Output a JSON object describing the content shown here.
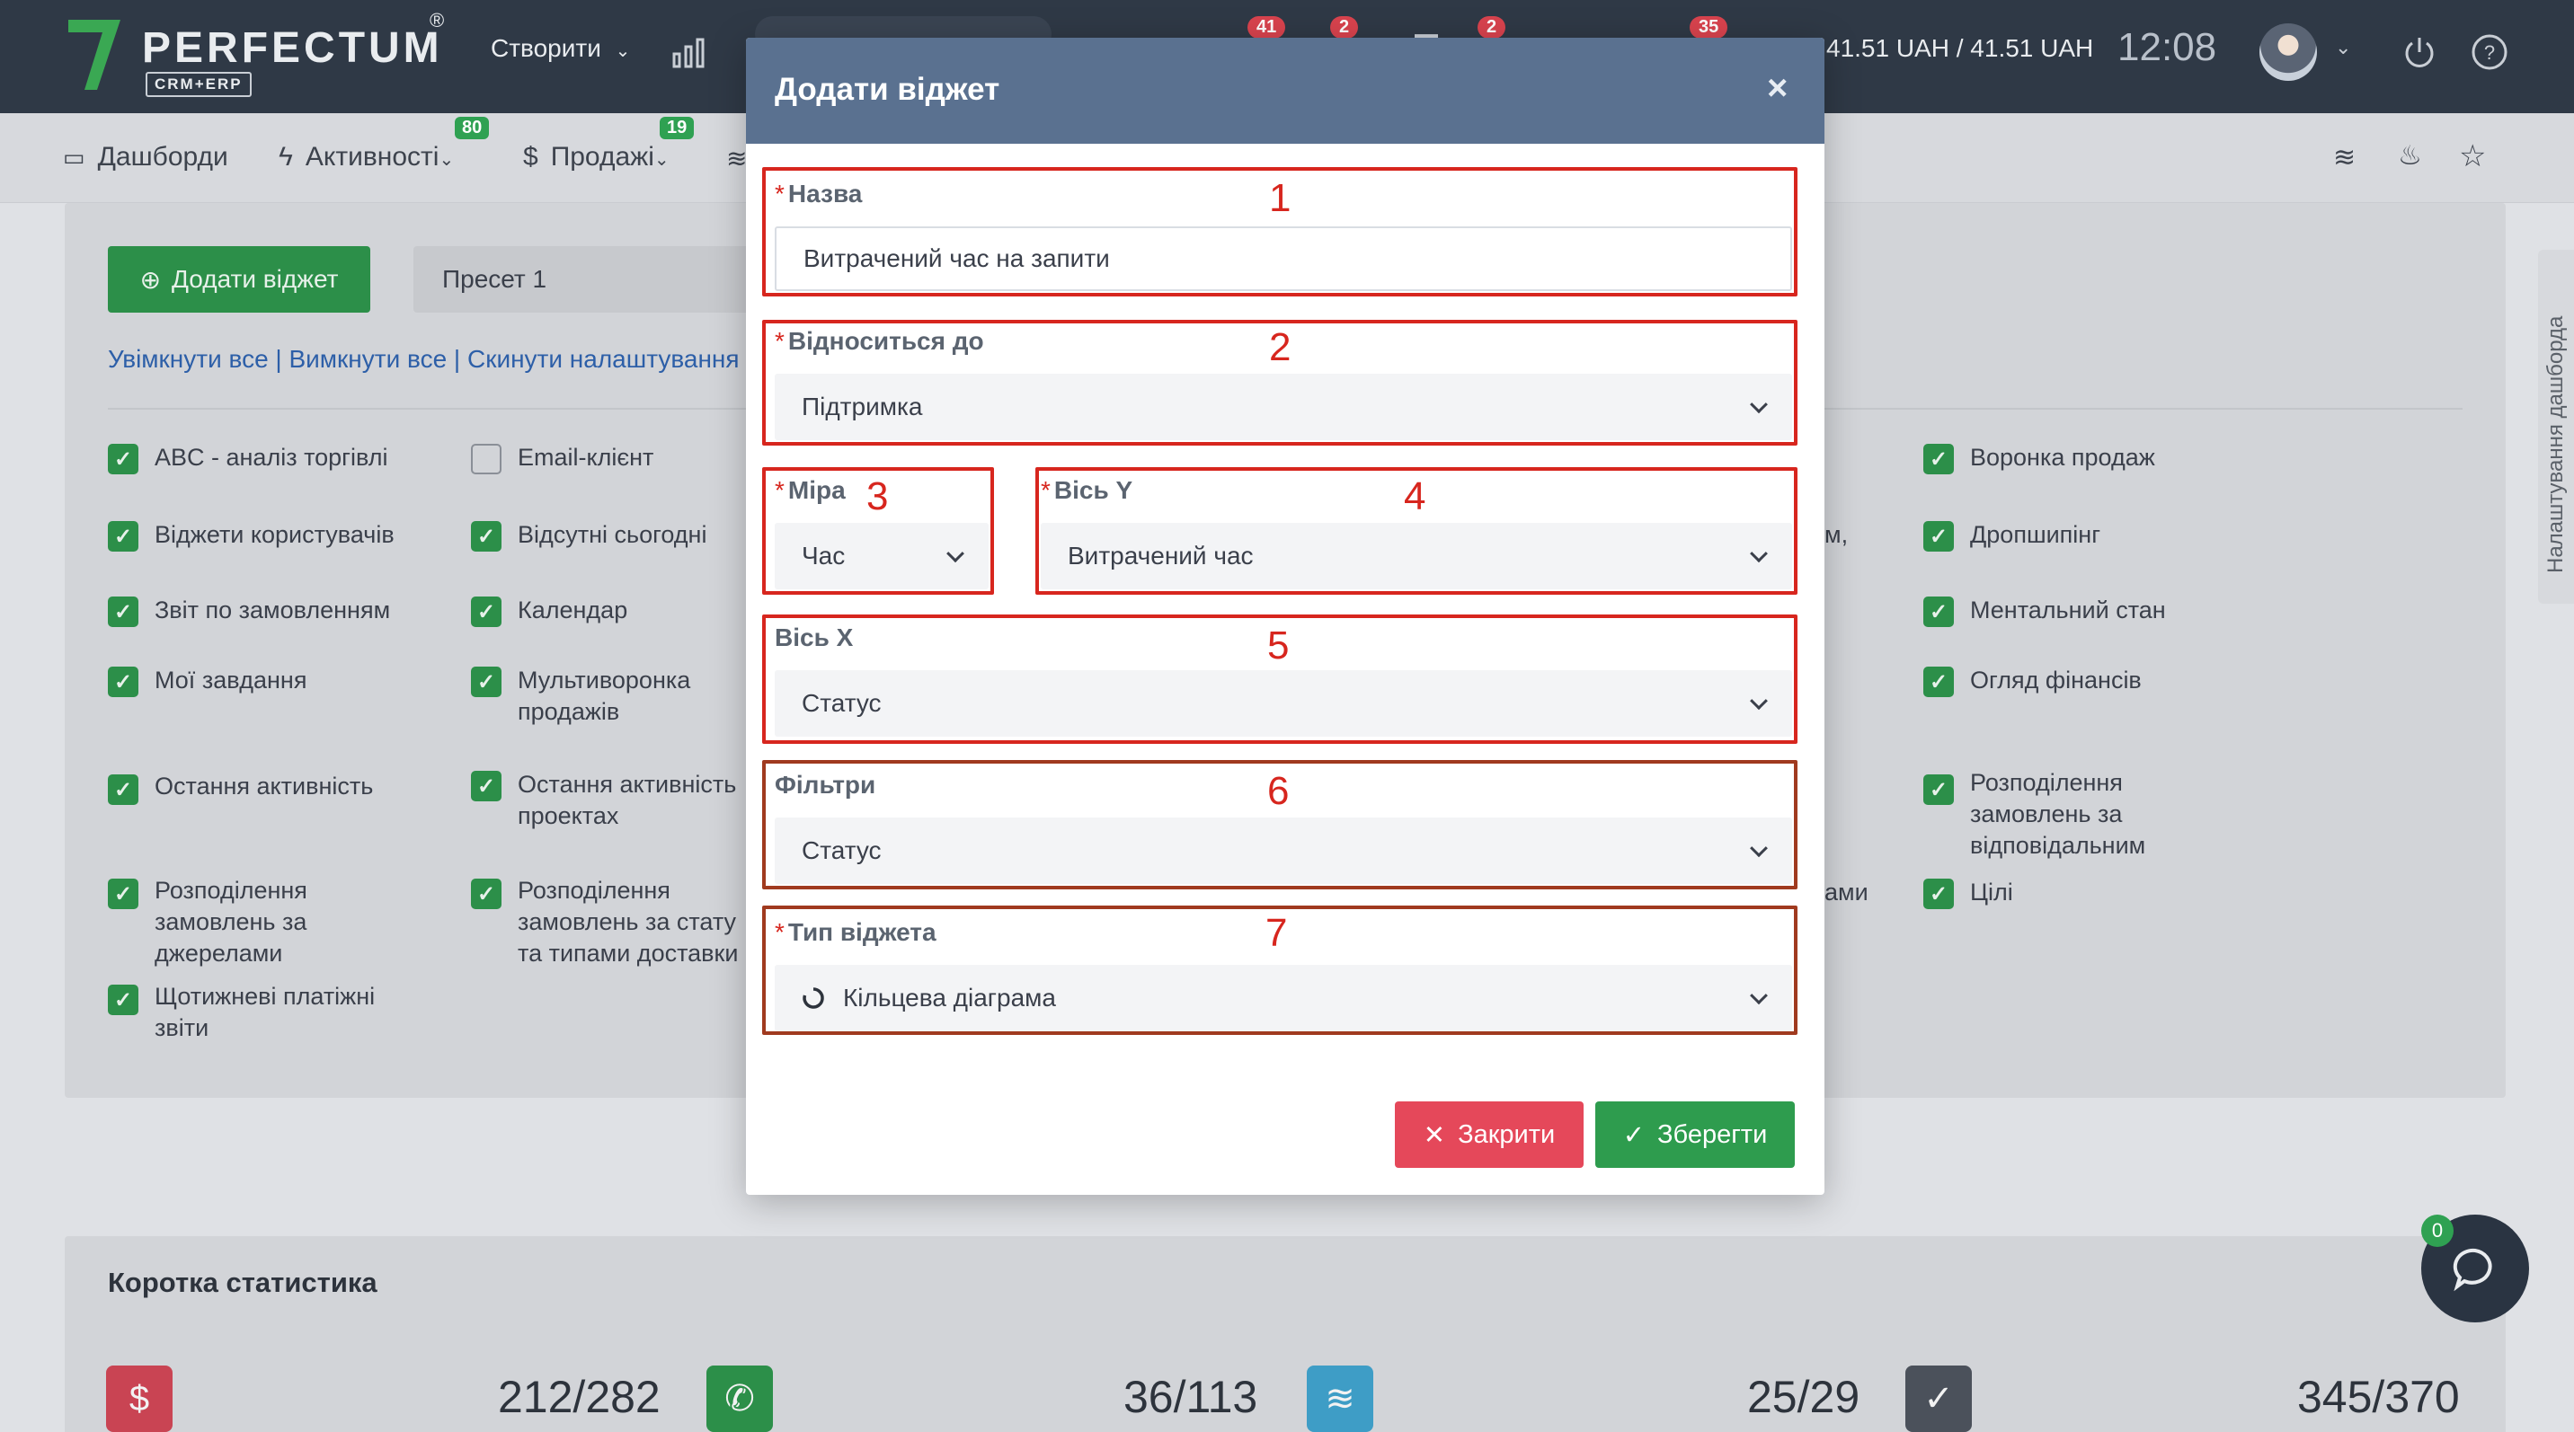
{
  "header": {
    "logo_text": "PERFECTUM",
    "logo_sub": "CRM+ERP",
    "logo_reg": "®",
    "create_label": "Створити",
    "badges": [
      "41",
      "2",
      "2",
      "35"
    ],
    "balance": "41.51 UAH / 41.51 UAH",
    "time": "12:08"
  },
  "nav": {
    "items": [
      {
        "label": "Дашборди"
      },
      {
        "label": "Активності",
        "badge": "80"
      },
      {
        "label": "Продажі",
        "badge": "19"
      }
    ]
  },
  "dashboard": {
    "add_widget_label": "Додати віджет",
    "preset_label": "Пресет 1",
    "links_text": "Увімкнути все | Вимкнути все | Скинути налаштування",
    "side_tab_label": "Налаштування дашборда",
    "widgets_col1": [
      {
        "label": "ABC - аналіз торгівлі",
        "checked": true
      },
      {
        "label": "Віджети користувачів",
        "checked": true
      },
      {
        "label": "Звіт по замовленням",
        "checked": true
      },
      {
        "label": "Мої завдання",
        "checked": true
      },
      {
        "label": "Остання активність",
        "checked": true
      },
      {
        "label": "Розподілення замовлень за джерелами",
        "checked": true
      },
      {
        "label": "Щотижневі платіжні звіти",
        "checked": true
      }
    ],
    "widgets_col2": [
      {
        "label": "Email-клієнт",
        "checked": false
      },
      {
        "label": "Відсутні сьогодні",
        "checked": true
      },
      {
        "label": "Календар",
        "checked": true
      },
      {
        "label": "Мультиворонка продажів",
        "checked": true
      },
      {
        "label": "Остання активність проектах",
        "checked": true
      },
      {
        "label": "Розподілення замовлень за стату та типами доставки",
        "checked": true
      }
    ],
    "widgets_col4": [
      {
        "label": "Воронка продаж",
        "checked": true
      },
      {
        "label": "Дропшипінг",
        "checked": true
      },
      {
        "label": "Ментальний стан",
        "checked": true
      },
      {
        "label": "Огляд фінансів",
        "checked": true
      },
      {
        "label": "Розподілення замовлень за відповідальним",
        "checked": true
      },
      {
        "label": "Цілі",
        "checked": true
      }
    ],
    "partial_fragments": [
      "м,",
      "ами"
    ]
  },
  "stats": {
    "title": "Коротка статистика",
    "items": [
      {
        "icon": "dollar-icon",
        "value": "212/282",
        "color": "#c94453"
      },
      {
        "icon": "phone-call-icon",
        "value": "36/113",
        "color": "#2c8f49"
      },
      {
        "icon": "layers-icon",
        "value": "25/29",
        "color": "#3e9dc6"
      },
      {
        "icon": "check-circle-icon",
        "value": "345/370",
        "color": "#4b515b"
      }
    ],
    "chat_badge": "0"
  },
  "modal": {
    "title": "Додати віджет",
    "close_symbol": "×",
    "fields": {
      "name": {
        "label": "Назва",
        "value": "Витрачений час на запити",
        "number": "1"
      },
      "relates_to": {
        "label": "Відноситься до",
        "value": "Підтримка",
        "number": "2"
      },
      "measure": {
        "label": "Міра",
        "value": "Час",
        "number": "3"
      },
      "axis_y": {
        "label": "Вісь Y",
        "value": "Витрачений час",
        "number": "4"
      },
      "axis_x": {
        "label": "Вісь X",
        "value": "Статус",
        "number": "5"
      },
      "filters": {
        "label": "Фільтри",
        "value": "Статус",
        "number": "6"
      },
      "widget_type": {
        "label": "Тип віджета",
        "value": "Кільцева діаграма",
        "number": "7"
      }
    },
    "close_button": "Закрити",
    "save_button": "Зберегти",
    "required_mark": "*"
  }
}
